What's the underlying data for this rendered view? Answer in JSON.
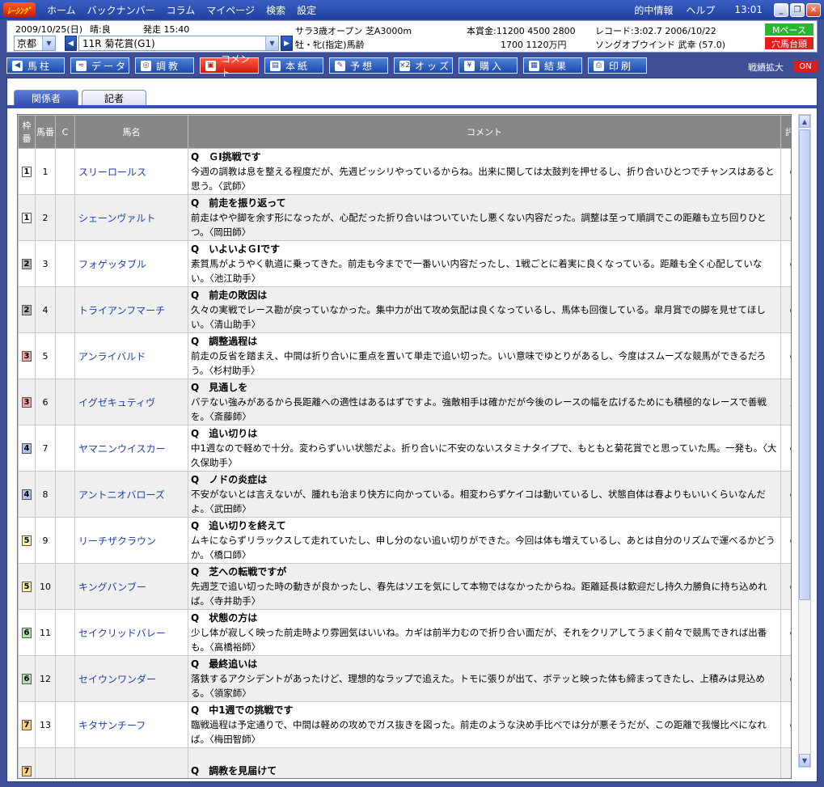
{
  "menubar": {
    "logo": "ﾚｰｼﾝｸﾞ",
    "items": [
      "ホーム",
      "バックナンバー",
      "コラム",
      "マイページ",
      "検索",
      "設定"
    ],
    "right": [
      "的中情報",
      "ヘルプ"
    ],
    "clock": "13:01",
    "win": {
      "min": "_",
      "max": "❐",
      "close": "✕"
    }
  },
  "race": {
    "date": "2009/10/25(日)",
    "weather": "晴:良",
    "post": "発走 15:40",
    "venue": "京都",
    "race_name": "11R 菊花賞(G1)",
    "cond1": "サラ3歳オープン 芝A3000m",
    "cond2": "牡・牝(指定)馬齢",
    "prize1": "本賞金:11200 4500 2800",
    "prize2": "1700 1120万円",
    "record1": "レコード:3:02.7 2006/10/22",
    "record2": "ソングオブウインド 武幸 (57.0)",
    "badge1": "Mペース",
    "badge2": "穴馬台頭"
  },
  "toolbar": {
    "items": [
      {
        "label": "馬柱",
        "icon": "◀"
      },
      {
        "label": "データ",
        "icon": "≈"
      },
      {
        "label": "調教",
        "icon": "◎"
      },
      {
        "label": "コメント",
        "icon": "▣"
      },
      {
        "label": "本紙",
        "icon": "▤"
      },
      {
        "label": "予想",
        "icon": "✎"
      },
      {
        "label": "オッズ",
        "icon": "×2"
      },
      {
        "label": "購入",
        "icon": "¥"
      },
      {
        "label": "結果",
        "icon": "▦"
      },
      {
        "label": "印刷",
        "icon": "⎙"
      }
    ],
    "expand": "戦績拡大",
    "toggle": "ON"
  },
  "tabs": [
    "関係者",
    "記者"
  ],
  "table": {
    "headers": {
      "waku": "枠番",
      "uma": "馬番",
      "c": "C",
      "name": "馬名",
      "comment": "コメント",
      "eval": "評価"
    },
    "rows": [
      {
        "waku": "1",
        "uma": "1",
        "name": "スリーロールス",
        "q": "Q　ＧⅠ挑戦です",
        "text": "今週の調教は息を整える程度だが、先週ビッシリやっているからね。出来に関しては太鼓判を押せるし、折り合いひとつでチャンスはあると思う。〈武師〉",
        "eval": "○"
      },
      {
        "waku": "1",
        "uma": "2",
        "name": "シェーンヴァルト",
        "q": "Q　前走を振り返って",
        "text": "前走はやや脚を余す形になったが、心配だった折り合いはついていたし悪くない内容だった。調整は至って順調でこの距離も立ち回りひとつ。〈岡田師〉",
        "eval": "○"
      },
      {
        "waku": "2",
        "uma": "3",
        "name": "フォゲッタブル",
        "q": "Q　いよいよＧⅠです",
        "text": "素質馬がようやく軌道に乗ってきた。前走も今までで一番いい内容だったし、1戦ごとに着実に良くなっている。距離も全く心配していない。〈池江助手〉",
        "eval": "○"
      },
      {
        "waku": "2",
        "uma": "4",
        "name": "トライアンフマーチ",
        "q": "Q　前走の敗因は",
        "text": "久々の実戦でレース勘が戻っていなかった。集中力が出て攻め気配は良くなっているし、馬体も回復している。皐月賞での脚を見せてほしい。〈清山助手〉",
        "eval": "○"
      },
      {
        "waku": "3",
        "uma": "5",
        "name": "アンライバルド",
        "q": "Q　調整過程は",
        "text": "前走の反省を踏まえ、中間は折り合いに重点を置いて単走で追い切った。いい意味でゆとりがあるし、今度はスムーズな競馬ができるだろう。〈杉村助手〉",
        "eval": "◎"
      },
      {
        "waku": "3",
        "uma": "6",
        "name": "イグゼキュティヴ",
        "q": "Q　見通しを",
        "text": "バテない強みがあるから長距離への適性はあるはずですよ。強敵相手は確かだが今後のレースの幅を広げるためにも積極的なレースで善戦を。〈斎藤師〉",
        "eval": "△"
      },
      {
        "waku": "4",
        "uma": "7",
        "name": "ヤマニンウイスカー",
        "q": "Q　追い切りは",
        "text": "中1週なので軽めで十分。変わらずいい状態だよ。折り合いに不安のないスタミナタイプで、もともと菊花賞でと思っていた馬。一発も。〈大久保助手〉",
        "eval": "◎"
      },
      {
        "waku": "4",
        "uma": "8",
        "name": "アントニオバローズ",
        "q": "Q　ノドの炎症は",
        "text": "不安がないとは言えないが、腫れも治まり快方に向かっている。相変わらずケイコは動いているし、状態自体は春よりもいいくらいなんだよ。〈武田師〉",
        "eval": "○"
      },
      {
        "waku": "5",
        "uma": "9",
        "name": "リーチザクラウン",
        "q": "Q　追い切りを終えて",
        "text": "ムキにならずリラックスして走れていたし、申し分のない追い切りができた。今回は体も増えているし、あとは自分のリズムで運べるかどうか。〈橋口師〉",
        "eval": "◎"
      },
      {
        "waku": "5",
        "uma": "10",
        "name": "キングバンブー",
        "q": "Q　芝への転戦ですが",
        "text": "先週芝で追い切った時の動きが良かったし、春先はソエを気にして本物ではなかったからね。距離延長は歓迎だし持久力勝負に持ち込めれば。〈寺井助手〉",
        "eval": "○"
      },
      {
        "waku": "6",
        "uma": "11",
        "name": "セイクリッドバレー",
        "q": "Q　状態の方は",
        "text": "少し体が寂しく映った前走時より雰囲気はいいね。カギは前半力むので折り合い面だが、それをクリアしてうまく前々で競馬できれば出番も。〈高橋裕師〉",
        "eval": "○"
      },
      {
        "waku": "6",
        "uma": "12",
        "name": "セイウンワンダー",
        "q": "Q　最終追いは",
        "text": "落鉄するアクシデントがあったけど、理想的なラップで追えた。トモに張りが出て、ボテッと映った体も締まってきたし、上積みは見込める。〈領家師〉",
        "eval": "○"
      },
      {
        "waku": "7",
        "uma": "13",
        "name": "キタサンチーフ",
        "q": "Q　中1週での挑戦です",
        "text": "臨戦過程は予定通りで、中間は軽めの攻めでガス抜きを図った。前走のような決め手比べでは分が悪そうだが、この距離で我慢比べになれば。〈梅田智師〉",
        "eval": "○"
      },
      {
        "waku": "7",
        "uma": "",
        "name": "",
        "q": "Q　調教を見届けて",
        "text": "",
        "eval": ""
      }
    ]
  },
  "colors": {
    "waku1": "#ffffff",
    "waku2": "#b5b5b5",
    "waku3": "#f4a3a3",
    "waku4": "#a9c2ee",
    "waku5": "#fff2a8",
    "waku6": "#b6e0b1",
    "waku7": "#ffd07a",
    "accent": "#3450b1"
  }
}
